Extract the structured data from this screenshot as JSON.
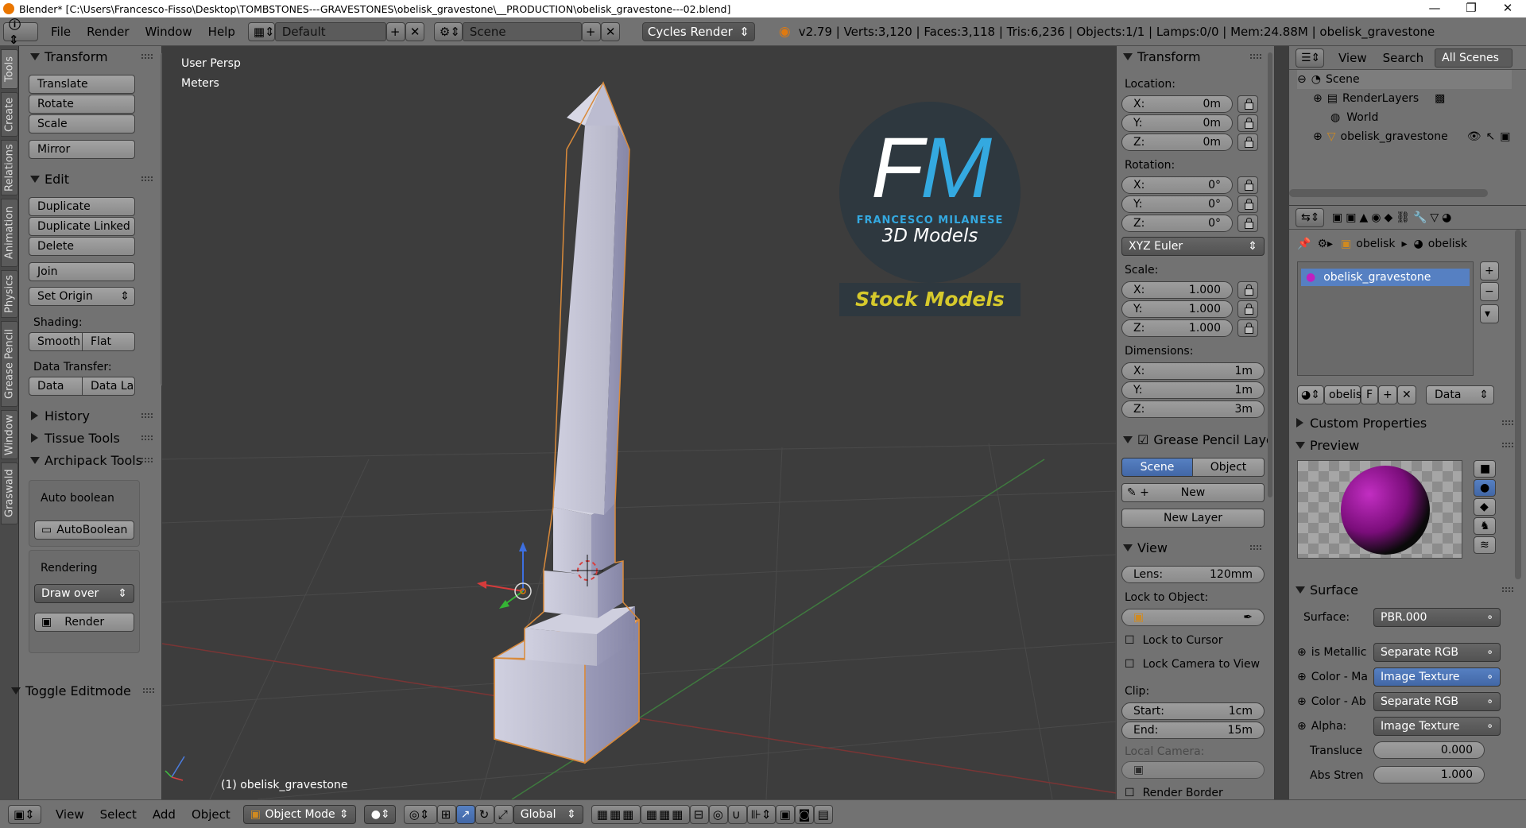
{
  "titlebar": {
    "title": "Blender* [C:\\Users\\Francesco-Fisso\\Desktop\\TOMBSTONES---GRAVESTONES\\obelisk_gravestone\\__PRODUCTION\\obelisk_gravestone---02.blend]",
    "minimize": "—",
    "maximize": "❐",
    "close": "✕"
  },
  "infobar": {
    "menus": [
      "File",
      "Render",
      "Window",
      "Help"
    ],
    "screen_layout": "Default",
    "scene": "Scene",
    "render_engine": "Cycles Render",
    "stats": "v2.79 | Verts:3,120 | Faces:3,118 | Tris:6,236 | Objects:1/1 | Lamps:0/0 | Mem:24.88M | obelisk_gravestone"
  },
  "tool_tabs": [
    "Tools",
    "Create",
    "Relations",
    "Animation",
    "Physics",
    "Grease Pencil",
    "Window",
    "Graswald"
  ],
  "toolshelf": {
    "transform_header": "Transform",
    "translate": "Translate",
    "rotate": "Rotate",
    "scale": "Scale",
    "mirror": "Mirror",
    "edit_header": "Edit",
    "duplicate": "Duplicate",
    "duplicate_linked": "Duplicate Linked",
    "delete": "Delete",
    "join": "Join",
    "set_origin": "Set Origin",
    "shading_label": "Shading:",
    "smooth": "Smooth",
    "flat": "Flat",
    "data_transfer_label": "Data Transfer:",
    "data": "Data",
    "data_la": "Data La",
    "history": "History",
    "tissue_tools": "Tissue Tools",
    "archipack_tools": "Archipack Tools",
    "auto_boolean_label": "Auto boolean",
    "auto_boolean_btn": "AutoBoolean",
    "rendering_label": "Rendering",
    "draw_over": "Draw over",
    "render_btn": "Render",
    "toggle_editmode": "Toggle Editmode"
  },
  "viewport": {
    "view_name": "User Persp",
    "units": "Meters",
    "object_label": "(1) obelisk_gravestone",
    "watermark_letters": "FM",
    "watermark_name": "FRANCESCO MILANESE",
    "watermark_sub": "3D Models",
    "watermark_banner": "Stock Models"
  },
  "npanel": {
    "transform_header": "Transform",
    "location_label": "Location:",
    "location": [
      {
        "axis": "X:",
        "value": "0m"
      },
      {
        "axis": "Y:",
        "value": "0m"
      },
      {
        "axis": "Z:",
        "value": "0m"
      }
    ],
    "rotation_label": "Rotation:",
    "rotation": [
      {
        "axis": "X:",
        "value": "0°"
      },
      {
        "axis": "Y:",
        "value": "0°"
      },
      {
        "axis": "Z:",
        "value": "0°"
      }
    ],
    "rotation_mode": "XYZ Euler",
    "scale_label": "Scale:",
    "scale": [
      {
        "axis": "X:",
        "value": "1.000"
      },
      {
        "axis": "Y:",
        "value": "1.000"
      },
      {
        "axis": "Z:",
        "value": "1.000"
      }
    ],
    "dimensions_label": "Dimensions:",
    "dimensions": [
      {
        "axis": "X:",
        "value": "1m"
      },
      {
        "axis": "Y:",
        "value": "1m"
      },
      {
        "axis": "Z:",
        "value": "3m"
      }
    ],
    "grease_pencil_header": "Grease Pencil Layer",
    "gp_scene": "Scene",
    "gp_object": "Object",
    "gp_new": "New",
    "gp_new_layer": "New Layer",
    "view_header": "View",
    "lens_label": "Lens:",
    "lens_value": "120mm",
    "lock_to_object_label": "Lock to Object:",
    "lock_to_cursor": "Lock to Cursor",
    "lock_camera_to_view": "Lock Camera to View",
    "clip_label": "Clip:",
    "clip_start_label": "Start:",
    "clip_start": "1cm",
    "clip_end_label": "End:",
    "clip_end": "15m",
    "local_camera_label": "Local Camera:",
    "render_border": "Render Border"
  },
  "outliner": {
    "view": "View",
    "search": "Search",
    "filter": "All Scenes",
    "tree": [
      "Scene",
      "RenderLayers",
      "World",
      "obelisk_gravestone"
    ]
  },
  "properties": {
    "breadcrumb_object": "obelisk",
    "breadcrumb_material": "obelisk",
    "material_slot": "obelisk_gravestone",
    "material_name_short": "obelis",
    "fake_user": "F",
    "link_mode": "Data",
    "custom_properties": "Custom Properties",
    "preview": "Preview",
    "surface_header": "Surface",
    "surface_label": "Surface:",
    "surface_value": "PBR.000",
    "inputs": [
      {
        "label": "is Metallic",
        "value": "Separate RGB"
      },
      {
        "label": "Color - Ma",
        "value": "Image Texture"
      },
      {
        "label": "Color - Ab",
        "value": "Separate RGB"
      },
      {
        "label": "Alpha:",
        "value": "Image Texture"
      }
    ],
    "transluce_label": "Transluce",
    "transluce_value": "0.000",
    "abs_stren_label": "Abs Stren",
    "abs_stren_value": "1.000"
  },
  "bottombar": {
    "menus": [
      "View",
      "Select",
      "Add",
      "Object"
    ],
    "mode": "Object Mode",
    "orientation": "Global"
  }
}
